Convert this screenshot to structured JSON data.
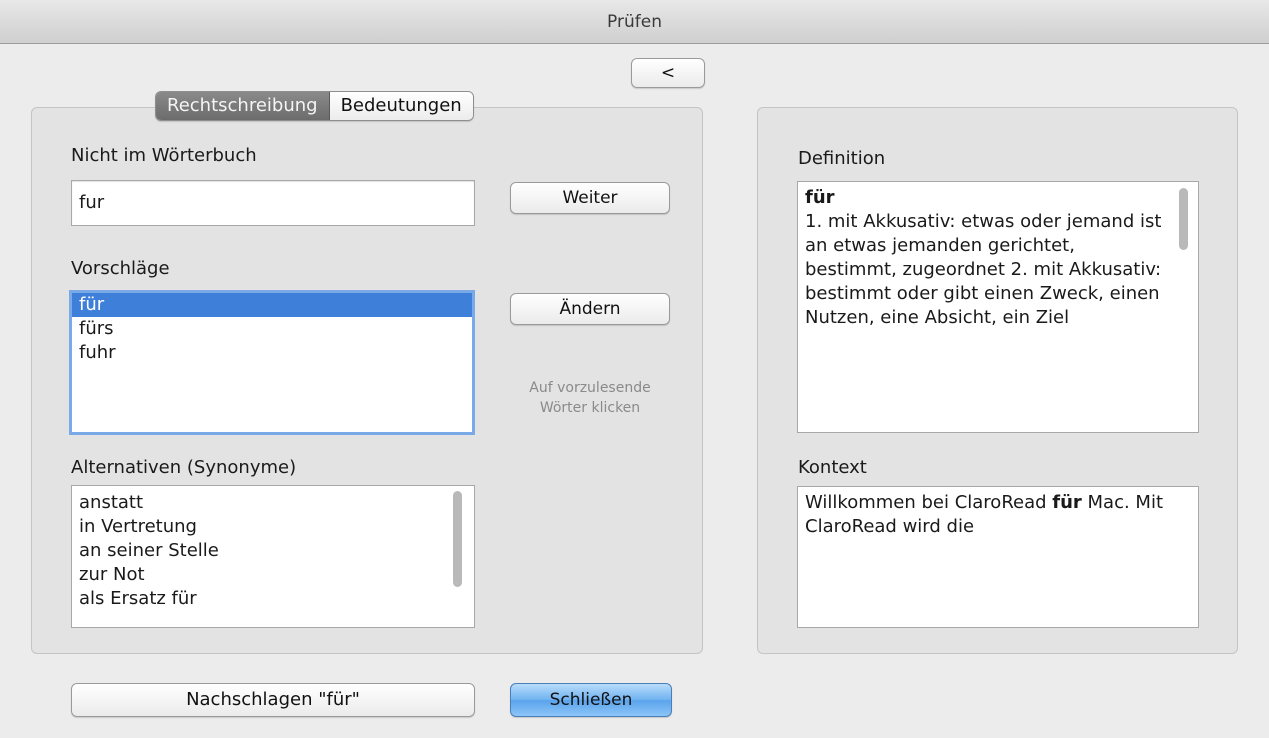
{
  "window": {
    "title": "Prüfen"
  },
  "back_button": {
    "label": "<"
  },
  "tabs": [
    {
      "label": "Rechtschreibung",
      "active": true
    },
    {
      "label": "Bedeutungen",
      "active": false
    }
  ],
  "spelling": {
    "not_in_dictionary_label": "Nicht im Wörterbuch",
    "word_value": "fur",
    "continue_button": "Weiter",
    "suggestions_label": "Vorschläge",
    "suggestions": [
      "für",
      "fürs",
      "fuhr"
    ],
    "selected_suggestion": "für",
    "change_button": "Ändern",
    "hint_line1": "Auf vorzulesende",
    "hint_line2": "Wörter klicken",
    "alternatives_label": "Alternativen (Synonyme)",
    "alternatives": [
      "anstatt",
      "in Vertretung",
      "an seiner Stelle",
      "zur Not",
      "als Ersatz für"
    ]
  },
  "definition": {
    "label": "Definition",
    "word": "für",
    "text": "1. mit Akkusativ: etwas oder jemand ist an etwas jemanden gerichtet, bestimmt, zugeordnet 2. mit Akkusativ: bestimmt oder gibt einen Zweck, einen Nutzen, eine Absicht, ein Ziel"
  },
  "context": {
    "label": "Kontext",
    "text_before": "Willkommen bei ClaroRead ",
    "highlight": "für",
    "text_after": " Mac. Mit ClaroRead wird die"
  },
  "footer": {
    "lookup_button": "Nachschlagen \"für\"",
    "close_button": "Schließen"
  },
  "colors": {
    "selection": "#3d7fd9",
    "focus_ring": "#79a9e6",
    "default_button": "#6fb2f0"
  }
}
